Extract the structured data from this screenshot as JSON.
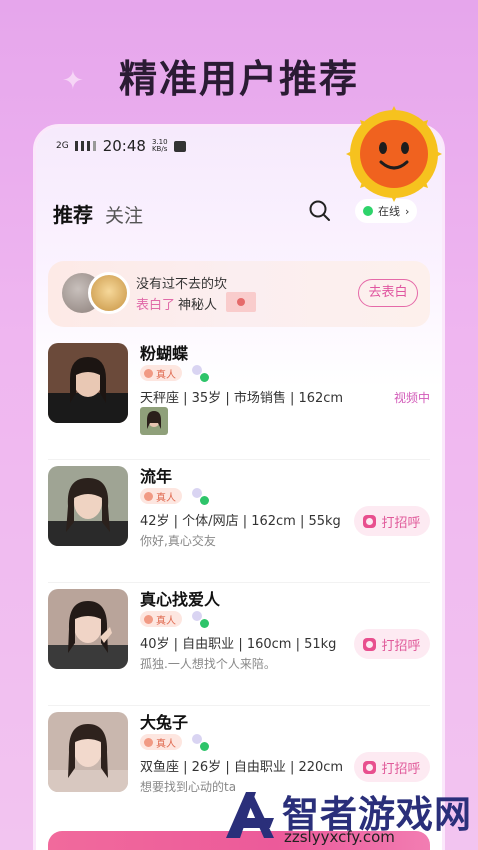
{
  "headline": "精准用户推荐",
  "status_bar": {
    "network": "2G",
    "time": "20:48",
    "speed": "3.10",
    "speed_unit": "KB/s"
  },
  "header": {
    "tab_active": "推荐",
    "tab_other": "关注",
    "online_label": "在线",
    "online_chevron": "›",
    "icons": [
      "search-icon",
      "sun-sticker"
    ]
  },
  "banner": {
    "line1": "没有过不去的坎",
    "line2_action": "表白了",
    "line2_target": "神秘人",
    "button": "去表白"
  },
  "users": [
    {
      "name": "粉蝴蝶",
      "badge": "真人",
      "info": "天秤座 | 35岁 | 市场销售 | 162cm",
      "bio": "",
      "status": "视频中"
    },
    {
      "name": "流年",
      "badge": "真人",
      "info": "42岁 | 个体/网店 | 162cm | 55kg",
      "bio": "你好,真心交友",
      "action": "打招呼"
    },
    {
      "name": "真心找爱人",
      "badge": "真人",
      "info": "40岁 | 自由职业 | 160cm | 51kg",
      "bio": "孤独.一人想找个人来陪。",
      "action": "打招呼"
    },
    {
      "name": "大兔子",
      "badge": "真人",
      "info": "双鱼座 | 26岁 | 自由职业 | 220cm",
      "bio": "想要找到心动的ta",
      "action": "打招呼"
    }
  ],
  "watermark": {
    "title": "智者游戏网",
    "url": "zzslyyxcfy.com"
  },
  "colors": {
    "accent_pink": "#e05a9a",
    "online_green": "#2ed36a",
    "background": "#efb6f0"
  }
}
